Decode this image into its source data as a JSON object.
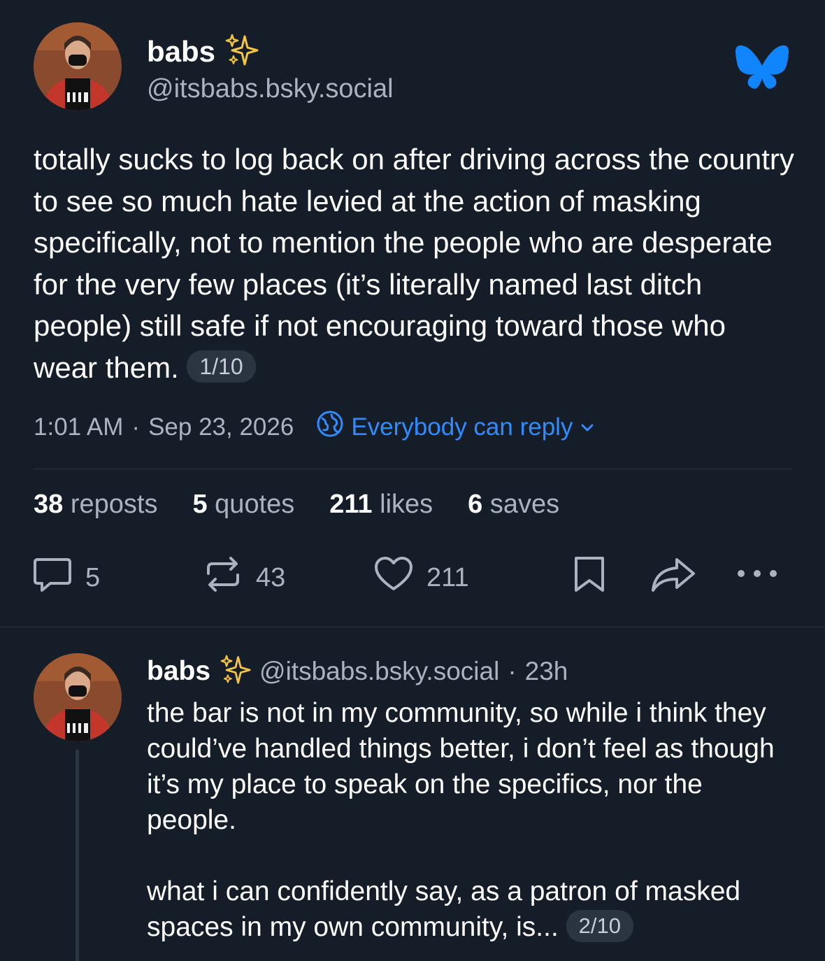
{
  "post": {
    "author_name": "babs",
    "author_handle": "@itsbabs.bsky.social",
    "text": "totally sucks to log back on after driving across the country to see so much hate levied at the action of masking specifically, not to mention the people who are desperate for the very few places (it’s literally named last ditch people) still safe if not encouraging toward those who wear them.",
    "thread_position": "1/10",
    "time": "1:01 AM",
    "date": "Sep 23, 2026",
    "separator": "·",
    "reply_setting": "Everybody can reply",
    "stats": {
      "reposts_count": "38",
      "reposts_label": "reposts",
      "quotes_count": "5",
      "quotes_label": "quotes",
      "likes_count": "211",
      "likes_label": "likes",
      "saves_count": "6",
      "saves_label": "saves"
    },
    "actions": {
      "replies": "5",
      "reposts": "43",
      "likes": "211"
    }
  },
  "reply": {
    "author_name": "babs",
    "author_handle": "@itsbabs.bsky.social",
    "time_ago": "23h",
    "separator": "·",
    "paragraph1": "the bar is not in my community, so while i think they could’ve handled things better, i don’t feel as though it’s my place to speak on the specifics, nor the people.",
    "paragraph2": "what i can confidently say, as a patron of masked spaces in my own community, is...",
    "thread_position": "2/10"
  },
  "icons": {
    "app_logo": "bluesky-butterfly-icon",
    "sparkle": "sparkles-icon",
    "globe": "globe-icon",
    "chevron": "chevron-down-icon",
    "reply": "comment-icon",
    "repost": "repost-icon",
    "like": "heart-icon",
    "save": "bookmark-icon",
    "share": "share-icon",
    "more": "more-dots-icon"
  },
  "colors": {
    "background": "#151d28",
    "accent": "#2f8cff",
    "muted": "#aab3bf"
  }
}
